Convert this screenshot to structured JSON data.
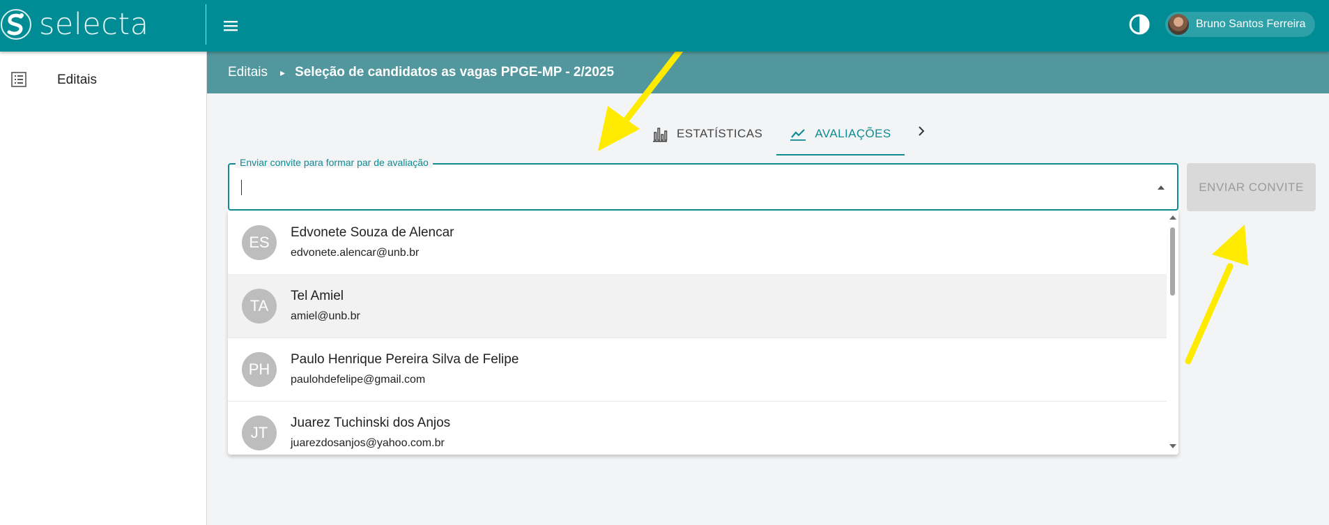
{
  "appbar": {
    "logo_text": "selecta",
    "user_name": "Bruno Santos Ferreira",
    "color": "#008c94"
  },
  "sidebar": {
    "items": [
      {
        "label": "Editais",
        "icon": "list-icon"
      }
    ]
  },
  "breadcrumb": {
    "root": "Editais",
    "current": "Seleção de candidatos as vagas PPGE-MP - 2/2025",
    "color": "#52979d"
  },
  "tabs": [
    {
      "label": "ESTATÍSTICAS",
      "icon": "bar-chart-icon",
      "active": false
    },
    {
      "label": "AVALIAÇÕES",
      "icon": "trending-icon",
      "active": true
    }
  ],
  "invite": {
    "field_label": "Enviar convite para formar par de avaliação",
    "value": "",
    "button_label": "ENVIAR CONVITE",
    "button_enabled": false,
    "accent": "#0e8c92"
  },
  "options": [
    {
      "initials": "ES",
      "name": "Edvonete Souza de Alencar",
      "email": "edvonete.alencar@unb.br",
      "highlighted": false
    },
    {
      "initials": "TA",
      "name": "Tel Amiel",
      "email": "amiel@unb.br",
      "highlighted": true
    },
    {
      "initials": "PH",
      "name": "Paulo Henrique Pereira Silva de Felipe",
      "email": "paulohdefelipe@gmail.com",
      "highlighted": false
    },
    {
      "initials": "JT",
      "name": "Juarez Tuchinski dos Anjos",
      "email": "juarezdosanjos@yahoo.com.br",
      "highlighted": false
    }
  ],
  "annotation_color": "#ffeb00"
}
